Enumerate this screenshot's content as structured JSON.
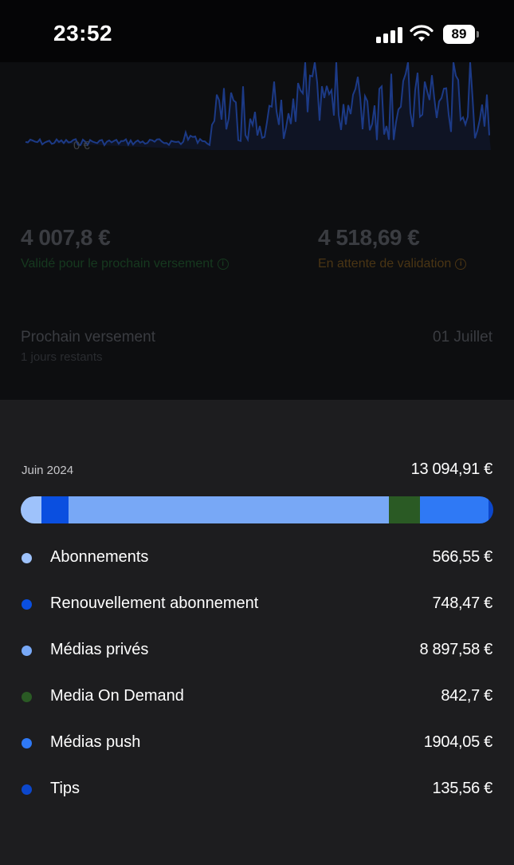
{
  "status_bar": {
    "time": "23:52",
    "battery": "89"
  },
  "dashboard": {
    "chart_zero_label": "0 €",
    "validated": {
      "amount": "4 007,8 €",
      "label": "Validé pour le prochain versement"
    },
    "pending": {
      "amount": "4 518,69 €",
      "label": "En attente de validation"
    },
    "payout": {
      "title": "Prochain versement",
      "subtitle": "1 jours restants",
      "date": "01 Juillet"
    }
  },
  "breakdown": {
    "month": "Juin 2024",
    "total": "13 094,91 €",
    "items": [
      {
        "label": "Abonnements",
        "value": "566,55 €",
        "amount": 566.55,
        "color": "#9ec2fb"
      },
      {
        "label": "Renouvellement abonnement",
        "value": "748,47 €",
        "amount": 748.47,
        "color": "#0a4fe0"
      },
      {
        "label": "Médias privés",
        "value": "8 897,58 €",
        "amount": 8897.58,
        "color": "#78a8f6"
      },
      {
        "label": "Media On Demand",
        "value": "842,7 €",
        "amount": 842.7,
        "color": "#2a5a24"
      },
      {
        "label": "Médias push",
        "value": "1904,05 €",
        "amount": 1904.05,
        "color": "#2f79f5"
      },
      {
        "label": "Tips",
        "value": "135,56 €",
        "amount": 135.56,
        "color": "#0c47cc"
      }
    ]
  },
  "colors": {
    "background": "#000000",
    "sheet": "#1d1d1f",
    "chart_line": "#1c3a86"
  }
}
